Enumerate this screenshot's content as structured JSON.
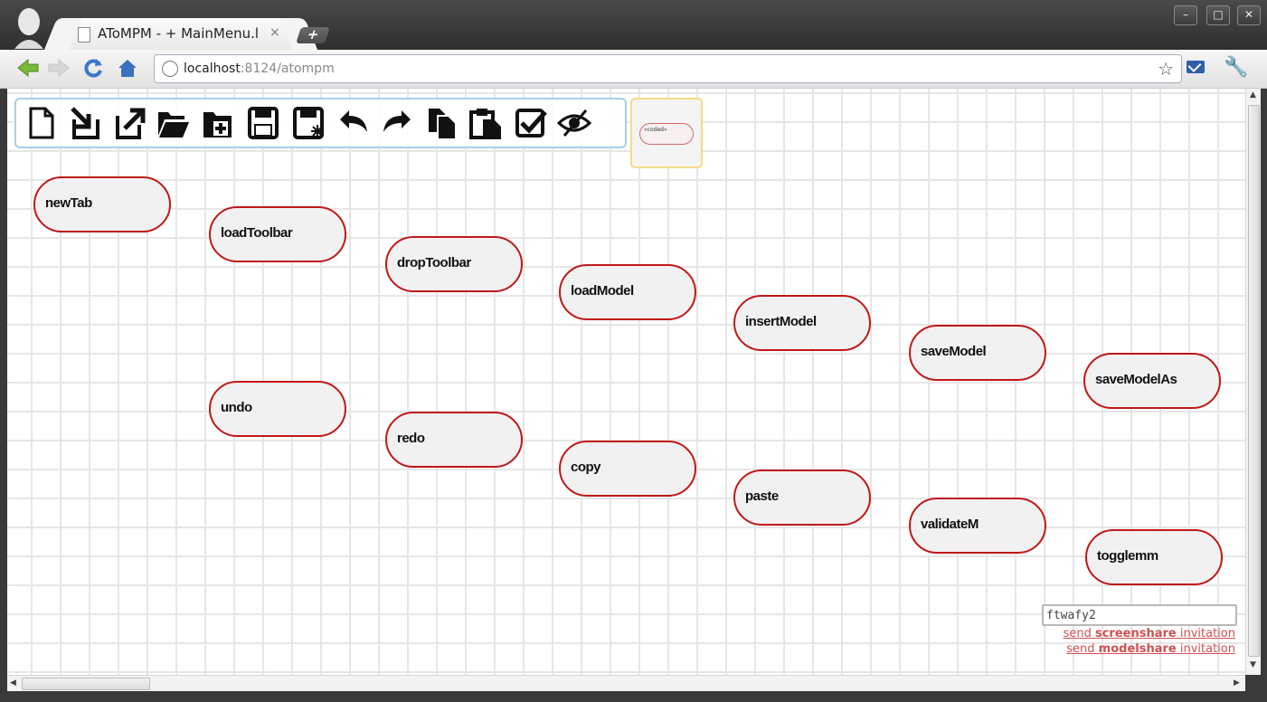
{
  "browser": {
    "tab_title": "AToMPM - + MainMenu.l",
    "tab_close": "×",
    "new_tab": "+",
    "url_host": "localhost",
    "url_rest": ":8124/atompm",
    "window_buttons": [
      "–",
      "□",
      "✕"
    ]
  },
  "canvas": {
    "coded_label": "«coded»",
    "toolbar_icons": [
      "new-file-icon",
      "load-toolbar-icon",
      "drop-toolbar-icon",
      "open-folder-icon",
      "insert-folder-icon",
      "save-icon",
      "save-as-icon",
      "undo-icon",
      "redo-icon",
      "copy-icon",
      "paste-icon",
      "validate-icon",
      "toggle-visibility-icon"
    ],
    "nodes": [
      "newTab",
      "loadToolbar",
      "dropToolbar",
      "loadModel",
      "insertModel",
      "saveModel",
      "saveModelAs",
      "undo",
      "redo",
      "copy",
      "paste",
      "validateM",
      "togglemm"
    ]
  },
  "share": {
    "input_value": "ftwafy2",
    "screenshare_prefix": "send ",
    "screenshare_bold": "screenshare",
    "screenshare_suffix": " invitation",
    "modelshare_prefix": "send ",
    "modelshare_bold": "modelshare",
    "modelshare_suffix": " invitation"
  },
  "colors": {
    "node_border": "#c01818",
    "toolbar_border": "#a7cfe8",
    "coded_border": "#f2dd86",
    "link": "#d05050"
  }
}
